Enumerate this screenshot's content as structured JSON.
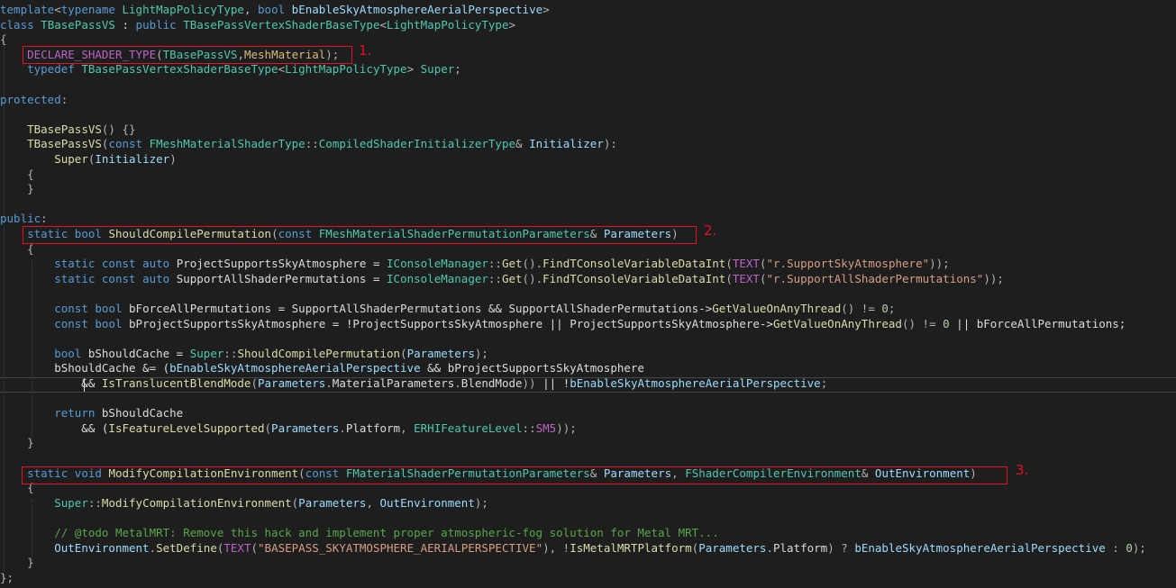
{
  "lines": [
    [
      [
        "k",
        "template"
      ],
      [
        "p",
        "<"
      ],
      [
        "k",
        "typename"
      ],
      [
        "v",
        " "
      ],
      [
        "t",
        "LightMapPolicyType"
      ],
      [
        "p",
        ", "
      ],
      [
        "k",
        "bool"
      ],
      [
        "v",
        " "
      ],
      [
        "g",
        "bEnableSkyAtmosphereAerialPerspective"
      ],
      [
        "p",
        ">"
      ]
    ],
    [
      [
        "k",
        "class"
      ],
      [
        "v",
        " "
      ],
      [
        "t",
        "TBasePassVS"
      ],
      [
        "v",
        " : "
      ],
      [
        "k",
        "public"
      ],
      [
        "v",
        " "
      ],
      [
        "t",
        "TBasePassVertexShaderBaseType"
      ],
      [
        "p",
        "<"
      ],
      [
        "t",
        "LightMapPolicyType"
      ],
      [
        "p",
        ">"
      ]
    ],
    [
      [
        "p",
        "{"
      ]
    ],
    [
      [
        "v",
        "    "
      ],
      [
        "m",
        "DECLARE_SHADER_TYPE"
      ],
      [
        "p",
        "("
      ],
      [
        "t",
        "TBasePassVS"
      ],
      [
        "p",
        ","
      ],
      [
        "o",
        "MeshMaterial"
      ],
      [
        "p",
        ");"
      ]
    ],
    [
      [
        "v",
        "    "
      ],
      [
        "k",
        "typedef"
      ],
      [
        "v",
        " "
      ],
      [
        "t",
        "TBasePassVertexShaderBaseType"
      ],
      [
        "p",
        "<"
      ],
      [
        "t",
        "LightMapPolicyType"
      ],
      [
        "p",
        "> "
      ],
      [
        "t",
        "Super"
      ],
      [
        "p",
        ";"
      ]
    ],
    [],
    [
      [
        "k",
        "protected"
      ],
      [
        "p",
        ":"
      ]
    ],
    [],
    [
      [
        "v",
        "    "
      ],
      [
        "f",
        "TBasePassVS"
      ],
      [
        "p",
        "() {}"
      ]
    ],
    [
      [
        "v",
        "    "
      ],
      [
        "f",
        "TBasePassVS"
      ],
      [
        "p",
        "("
      ],
      [
        "k",
        "const"
      ],
      [
        "v",
        " "
      ],
      [
        "t",
        "FMeshMaterialShaderType"
      ],
      [
        "p",
        "::"
      ],
      [
        "t",
        "CompiledShaderInitializerType"
      ],
      [
        "p",
        "& "
      ],
      [
        "g",
        "Initializer"
      ],
      [
        "p",
        "):"
      ]
    ],
    [
      [
        "v",
        "        "
      ],
      [
        "f",
        "Super"
      ],
      [
        "p",
        "("
      ],
      [
        "g",
        "Initializer"
      ],
      [
        "p",
        ")"
      ]
    ],
    [
      [
        "v",
        "    "
      ],
      [
        "p",
        "{"
      ]
    ],
    [
      [
        "v",
        "    "
      ],
      [
        "p",
        "}"
      ]
    ],
    [],
    [
      [
        "k",
        "public"
      ],
      [
        "p",
        ":"
      ]
    ],
    [
      [
        "v",
        "    "
      ],
      [
        "k",
        "static"
      ],
      [
        "v",
        " "
      ],
      [
        "k",
        "bool"
      ],
      [
        "v",
        " "
      ],
      [
        "f",
        "ShouldCompilePermutation"
      ],
      [
        "p",
        "("
      ],
      [
        "k",
        "const"
      ],
      [
        "v",
        " "
      ],
      [
        "t",
        "FMeshMaterialShaderPermutationParameters"
      ],
      [
        "p",
        "& "
      ],
      [
        "g",
        "Parameters"
      ],
      [
        "p",
        ")"
      ]
    ],
    [
      [
        "v",
        "    "
      ],
      [
        "p",
        "{"
      ]
    ],
    [
      [
        "v",
        "        "
      ],
      [
        "k",
        "static"
      ],
      [
        "v",
        " "
      ],
      [
        "k",
        "const"
      ],
      [
        "v",
        " "
      ],
      [
        "k",
        "auto"
      ],
      [
        "v",
        " ProjectSupportsSkyAtmosphere = "
      ],
      [
        "t",
        "IConsoleManager"
      ],
      [
        "p",
        "::"
      ],
      [
        "f",
        "Get"
      ],
      [
        "p",
        "()."
      ],
      [
        "f",
        "FindTConsoleVariableDataInt"
      ],
      [
        "p",
        "("
      ],
      [
        "m",
        "TEXT"
      ],
      [
        "p",
        "("
      ],
      [
        "s",
        "\"r.SupportSkyAtmosphere\""
      ],
      [
        "p",
        "));"
      ]
    ],
    [
      [
        "v",
        "        "
      ],
      [
        "k",
        "static"
      ],
      [
        "v",
        " "
      ],
      [
        "k",
        "const"
      ],
      [
        "v",
        " "
      ],
      [
        "k",
        "auto"
      ],
      [
        "v",
        " SupportAllShaderPermutations = "
      ],
      [
        "t",
        "IConsoleManager"
      ],
      [
        "p",
        "::"
      ],
      [
        "f",
        "Get"
      ],
      [
        "p",
        "()."
      ],
      [
        "f",
        "FindTConsoleVariableDataInt"
      ],
      [
        "p",
        "("
      ],
      [
        "m",
        "TEXT"
      ],
      [
        "p",
        "("
      ],
      [
        "s",
        "\"r.SupportAllShaderPermutations\""
      ],
      [
        "p",
        "));"
      ]
    ],
    [],
    [
      [
        "v",
        "        "
      ],
      [
        "k",
        "const"
      ],
      [
        "v",
        " "
      ],
      [
        "k",
        "bool"
      ],
      [
        "v",
        " bForceAllPermutations = SupportAllShaderPermutations && SupportAllShaderPermutations->"
      ],
      [
        "f",
        "GetValueOnAnyThread"
      ],
      [
        "p",
        "() != "
      ],
      [
        "n",
        "0"
      ],
      [
        "p",
        ";"
      ]
    ],
    [
      [
        "v",
        "        "
      ],
      [
        "k",
        "const"
      ],
      [
        "v",
        " "
      ],
      [
        "k",
        "bool"
      ],
      [
        "v",
        " bProjectSupportsSkyAtmosphere = !ProjectSupportsSkyAtmosphere || ProjectSupportsSkyAtmosphere->"
      ],
      [
        "f",
        "GetValueOnAnyThread"
      ],
      [
        "p",
        "() != "
      ],
      [
        "n",
        "0"
      ],
      [
        "v",
        " || bForceAllPermutations;"
      ]
    ],
    [],
    [
      [
        "v",
        "        "
      ],
      [
        "k",
        "bool"
      ],
      [
        "v",
        " bShouldCache = "
      ],
      [
        "t",
        "Super"
      ],
      [
        "p",
        "::"
      ],
      [
        "f",
        "ShouldCompilePermutation"
      ],
      [
        "p",
        "("
      ],
      [
        "g",
        "Parameters"
      ],
      [
        "p",
        ");"
      ]
    ],
    [
      [
        "v",
        "        bShouldCache &= ("
      ],
      [
        "g",
        "bEnableSkyAtmosphereAerialPerspective"
      ],
      [
        "v",
        " && bProjectSupportsSkyAtmosphere"
      ]
    ],
    [
      [
        "v",
        "            && "
      ],
      [
        "f",
        "IsTranslucentBlendMode"
      ],
      [
        "p",
        "("
      ],
      [
        "g",
        "Parameters"
      ],
      [
        "p",
        "."
      ],
      [
        "v",
        "MaterialParameters"
      ],
      [
        "p",
        "."
      ],
      [
        "v",
        "BlendMode"
      ],
      [
        "p",
        "))"
      ],
      [
        "v",
        " || !"
      ],
      [
        "g",
        "bEnableSkyAtmosphereAerialPerspective"
      ],
      [
        "p",
        ";"
      ]
    ],
    [],
    [
      [
        "v",
        "        "
      ],
      [
        "k",
        "return"
      ],
      [
        "v",
        " bShouldCache"
      ]
    ],
    [
      [
        "v",
        "            && ("
      ],
      [
        "f",
        "IsFeatureLevelSupported"
      ],
      [
        "p",
        "("
      ],
      [
        "g",
        "Parameters"
      ],
      [
        "p",
        "."
      ],
      [
        "v",
        "Platform"
      ],
      [
        "p",
        ", "
      ],
      [
        "t",
        "ERHIFeatureLevel"
      ],
      [
        "p",
        "::"
      ],
      [
        "m",
        "SM5"
      ],
      [
        "p",
        "));"
      ]
    ],
    [
      [
        "v",
        "    "
      ],
      [
        "p",
        "}"
      ]
    ],
    [],
    [
      [
        "v",
        "    "
      ],
      [
        "k",
        "static"
      ],
      [
        "v",
        " "
      ],
      [
        "k",
        "void"
      ],
      [
        "v",
        " "
      ],
      [
        "f",
        "ModifyCompilationEnvironment"
      ],
      [
        "p",
        "("
      ],
      [
        "k",
        "const"
      ],
      [
        "v",
        " "
      ],
      [
        "t",
        "FMaterialShaderPermutationParameters"
      ],
      [
        "p",
        "& "
      ],
      [
        "g",
        "Parameters"
      ],
      [
        "p",
        ", "
      ],
      [
        "t",
        "FShaderCompilerEnvironment"
      ],
      [
        "p",
        "& "
      ],
      [
        "g",
        "OutEnvironment"
      ],
      [
        "p",
        ")"
      ]
    ],
    [
      [
        "v",
        "    "
      ],
      [
        "p",
        "{"
      ]
    ],
    [
      [
        "v",
        "        "
      ],
      [
        "t",
        "Super"
      ],
      [
        "p",
        "::"
      ],
      [
        "f",
        "ModifyCompilationEnvironment"
      ],
      [
        "p",
        "("
      ],
      [
        "g",
        "Parameters"
      ],
      [
        "p",
        ", "
      ],
      [
        "g",
        "OutEnvironment"
      ],
      [
        "p",
        ");"
      ]
    ],
    [],
    [
      [
        "v",
        "        "
      ],
      [
        "c",
        "// @todo MetalMRT: Remove this hack and implement proper atmospheric-fog solution for Metal MRT..."
      ]
    ],
    [
      [
        "v",
        "        "
      ],
      [
        "g",
        "OutEnvironment"
      ],
      [
        "p",
        "."
      ],
      [
        "f",
        "SetDefine"
      ],
      [
        "p",
        "("
      ],
      [
        "m",
        "TEXT"
      ],
      [
        "p",
        "("
      ],
      [
        "s",
        "\"BASEPASS_SKYATMOSPHERE_AERIALPERSPECTIVE\""
      ],
      [
        "p",
        "), !"
      ],
      [
        "f",
        "IsMetalMRTPlatform"
      ],
      [
        "p",
        "("
      ],
      [
        "g",
        "Parameters"
      ],
      [
        "p",
        "."
      ],
      [
        "v",
        "Platform"
      ],
      [
        "p",
        ") ? "
      ],
      [
        "g",
        "bEnableSkyAtmosphereAerialPerspective"
      ],
      [
        "p",
        " : "
      ],
      [
        "n",
        "0"
      ],
      [
        "p",
        ");"
      ]
    ],
    [
      [
        "v",
        "    "
      ],
      [
        "p",
        "}"
      ]
    ],
    [
      [
        "p",
        "};"
      ]
    ]
  ],
  "annotations": [
    {
      "label": "1."
    },
    {
      "label": "2."
    },
    {
      "label": "3."
    }
  ],
  "colors": {
    "background": "#1e1e1e",
    "keyword": "#569cd6",
    "type": "#4ec9b0",
    "function": "#dcdcaa",
    "string": "#d69d85",
    "comment": "#57a64a",
    "macro": "#bd63c5",
    "highlight_box": "#e81123"
  }
}
